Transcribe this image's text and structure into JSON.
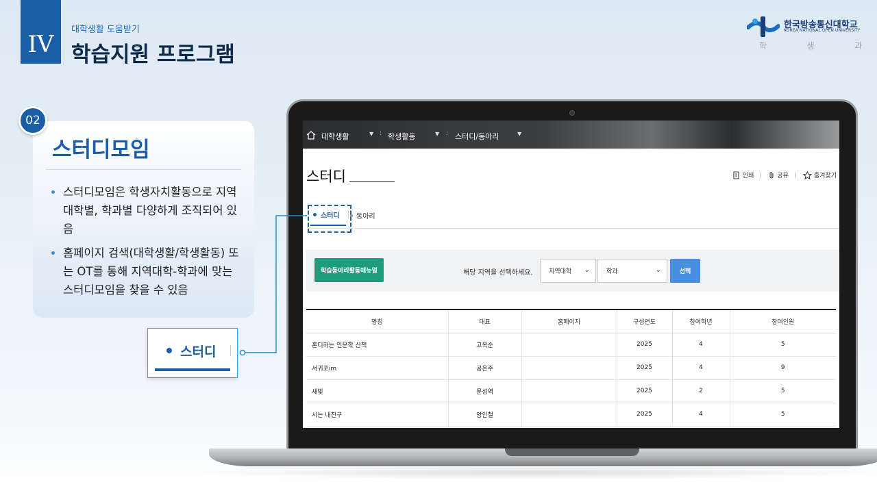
{
  "header": {
    "chapter_numeral": "IV",
    "chapter_subtitle": "대학생활 도움받기",
    "chapter_title": "학습지원 프로그램",
    "logo_name": "한국방송통신대학교",
    "logo_english": "KOREA NATIONAL OPEN UNIVERSITY",
    "logo_dept": [
      "학",
      "생",
      "과"
    ]
  },
  "card": {
    "badge": "02",
    "title": "스터디모임",
    "bullets": [
      "스터디모임은 학생자치활동으로 지역대학별, 학과별 다양하게 조직되어 있음",
      "홈페이지 검색(대학생활/학생활동) 또는 OT를 통해 지역대학-학과에 맞는 스터디모임을 찾을 수 있음"
    ]
  },
  "zoom_callout": {
    "label": "스터디"
  },
  "screen": {
    "breadcrumb": [
      "대학생활",
      "학생활동",
      "스터디/동아리"
    ],
    "page_title": "스터디",
    "tools": {
      "print": "인쇄",
      "share": "공유",
      "favorite": "즐겨찾기"
    },
    "tabs": {
      "study": "스터디",
      "club": "동아리"
    },
    "filter": {
      "manual_button": "학습동아리활동매뉴얼",
      "prompt": "해당 지역을 선택하세요.",
      "region_select": "지역대학",
      "dept_select": "학과",
      "select_button": "선택"
    },
    "table": {
      "headers": [
        "명칭",
        "대표",
        "홈페이지",
        "구성연도",
        "참여학년",
        "참여인원"
      ],
      "rows": [
        [
          "혼디하는 인문학 산책",
          "고옥순",
          "",
          "2025",
          "4",
          "5"
        ],
        [
          "서귀포im",
          "공은주",
          "",
          "2025",
          "4",
          "9"
        ],
        [
          "새빛",
          "문성역",
          "",
          "2025",
          "2",
          "5"
        ],
        [
          "시는 내친구",
          "양인철",
          "",
          "2025",
          "4",
          "5"
        ]
      ]
    }
  },
  "colors": {
    "brand_blue": "#1b5ea8",
    "accent_green": "#1e9d7c",
    "button_blue": "#4a90e2"
  }
}
